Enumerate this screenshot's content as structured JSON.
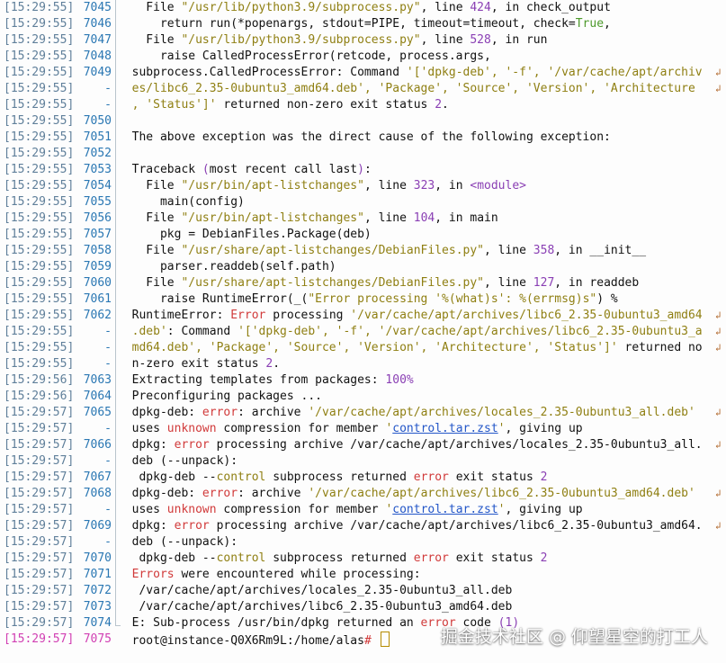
{
  "colors": {
    "background": "#fdfdfd",
    "timestamp": "#5f7f9a",
    "line_number": "#2a77b3",
    "active_line": "#d13fb3",
    "string": "#8f7f12",
    "number": "#8a3fb4",
    "error": "#d13a3a",
    "link": "#2356c8"
  },
  "icons": {
    "wrap": "wrap-continuation-icon",
    "cursor": "cursor-block-icon"
  },
  "terminal": {
    "lines": [
      {
        "ts": "[15:29:55]",
        "ln": "7045",
        "wrap": false,
        "segs": [
          [
            "plain",
            "    File "
          ],
          [
            "str",
            "\"/usr/lib/python3.9/subprocess.py\""
          ],
          [
            "plain",
            ", line "
          ],
          [
            "num",
            "424"
          ],
          [
            "plain",
            ", in check_output"
          ]
        ]
      },
      {
        "ts": "[15:29:55]",
        "ln": "7046",
        "wrap": false,
        "segs": [
          [
            "plain",
            "      return run(*popenargs, stdout=PIPE, timeout=timeout, check="
          ],
          [
            "green",
            "True"
          ],
          [
            "plain",
            ","
          ]
        ]
      },
      {
        "ts": "[15:29:55]",
        "ln": "7047",
        "wrap": false,
        "segs": [
          [
            "plain",
            "    File "
          ],
          [
            "str",
            "\"/usr/lib/python3.9/subprocess.py\""
          ],
          [
            "plain",
            ", line "
          ],
          [
            "num",
            "528"
          ],
          [
            "plain",
            ", in run"
          ]
        ]
      },
      {
        "ts": "[15:29:55]",
        "ln": "7048",
        "wrap": false,
        "segs": [
          [
            "plain",
            "      raise CalledProcessError(retcode, process.args,"
          ]
        ]
      },
      {
        "ts": "[15:29:55]",
        "ln": "7049",
        "wrap": true,
        "segs": [
          [
            "plain",
            "  subprocess.CalledProcessError: Command "
          ],
          [
            "str",
            "'['dpkg-deb', '-f', '/var/cache/apt/archiv"
          ]
        ]
      },
      {
        "ts": "[15:29:55]",
        "ln": "-",
        "wrap": true,
        "segs": [
          [
            "str",
            "  es/libc6_2.35-0ubuntu3_amd64.deb', 'Package', 'Source', 'Version', 'Architecture"
          ]
        ]
      },
      {
        "ts": "[15:29:55]",
        "ln": "-",
        "wrap": false,
        "segs": [
          [
            "str",
            "  , 'Status']'"
          ],
          [
            "plain",
            " returned non-zero exit status "
          ],
          [
            "num",
            "2"
          ],
          [
            "plain",
            "."
          ]
        ]
      },
      {
        "ts": "[15:29:55]",
        "ln": "7050",
        "wrap": false,
        "segs": [
          [
            "plain",
            ""
          ]
        ]
      },
      {
        "ts": "[15:29:55]",
        "ln": "7051",
        "wrap": false,
        "segs": [
          [
            "plain",
            "  The above exception was the direct cause of the following exception:"
          ]
        ]
      },
      {
        "ts": "[15:29:55]",
        "ln": "7052",
        "wrap": false,
        "segs": [
          [
            "plain",
            ""
          ]
        ]
      },
      {
        "ts": "[15:29:55]",
        "ln": "7053",
        "wrap": false,
        "segs": [
          [
            "plain",
            "  Traceback "
          ],
          [
            "kw",
            "("
          ],
          [
            "plain",
            "most recent call last"
          ],
          [
            "kw",
            ")"
          ],
          [
            "plain",
            ":"
          ]
        ]
      },
      {
        "ts": "[15:29:55]",
        "ln": "7054",
        "wrap": false,
        "segs": [
          [
            "plain",
            "    File "
          ],
          [
            "str",
            "\"/usr/bin/apt-listchanges\""
          ],
          [
            "plain",
            ", line "
          ],
          [
            "num",
            "323"
          ],
          [
            "plain",
            ", in "
          ],
          [
            "kw",
            "<module>"
          ]
        ]
      },
      {
        "ts": "[15:29:55]",
        "ln": "7055",
        "wrap": false,
        "segs": [
          [
            "plain",
            "      main(config)"
          ]
        ]
      },
      {
        "ts": "[15:29:55]",
        "ln": "7056",
        "wrap": false,
        "segs": [
          [
            "plain",
            "    File "
          ],
          [
            "str",
            "\"/usr/bin/apt-listchanges\""
          ],
          [
            "plain",
            ", line "
          ],
          [
            "num",
            "104"
          ],
          [
            "plain",
            ", in main"
          ]
        ]
      },
      {
        "ts": "[15:29:55]",
        "ln": "7057",
        "wrap": false,
        "segs": [
          [
            "plain",
            "      pkg = DebianFiles.Package(deb)"
          ]
        ]
      },
      {
        "ts": "[15:29:55]",
        "ln": "7058",
        "wrap": false,
        "segs": [
          [
            "plain",
            "    File "
          ],
          [
            "str",
            "\"/usr/share/apt-listchanges/DebianFiles.py\""
          ],
          [
            "plain",
            ", line "
          ],
          [
            "num",
            "358"
          ],
          [
            "plain",
            ", in __init__"
          ]
        ]
      },
      {
        "ts": "[15:29:55]",
        "ln": "7059",
        "wrap": false,
        "segs": [
          [
            "plain",
            "      parser.readdeb(self.path)"
          ]
        ]
      },
      {
        "ts": "[15:29:55]",
        "ln": "7060",
        "wrap": false,
        "segs": [
          [
            "plain",
            "    File "
          ],
          [
            "str",
            "\"/usr/share/apt-listchanges/DebianFiles.py\""
          ],
          [
            "plain",
            ", line "
          ],
          [
            "num",
            "127"
          ],
          [
            "plain",
            ", in readdeb"
          ]
        ]
      },
      {
        "ts": "[15:29:55]",
        "ln": "7061",
        "wrap": false,
        "segs": [
          [
            "plain",
            "      raise RuntimeError(_("
          ],
          [
            "str",
            "\"Error processing '%(what)s': %(errmsg)s\""
          ],
          [
            "plain",
            ") %"
          ]
        ]
      },
      {
        "ts": "[15:29:55]",
        "ln": "7062",
        "wrap": true,
        "segs": [
          [
            "plain",
            "  RuntimeError: "
          ],
          [
            "err",
            "Error"
          ],
          [
            "plain",
            " processing "
          ],
          [
            "str",
            "'/var/cache/apt/archives/libc6_2.35-0ubuntu3_amd64"
          ]
        ]
      },
      {
        "ts": "[15:29:55]",
        "ln": "-",
        "wrap": true,
        "segs": [
          [
            "str",
            "  .deb'"
          ],
          [
            "plain",
            ": Command "
          ],
          [
            "str",
            "'['dpkg-deb', '-f', '/var/cache/apt/archives/libc6_2.35-0ubuntu3_a"
          ]
        ]
      },
      {
        "ts": "[15:29:55]",
        "ln": "-",
        "wrap": true,
        "segs": [
          [
            "str",
            "  md64.deb', 'Package', 'Source', 'Version', 'Architecture', 'Status']'"
          ],
          [
            "plain",
            " returned no"
          ]
        ]
      },
      {
        "ts": "[15:29:55]",
        "ln": "-",
        "wrap": false,
        "segs": [
          [
            "plain",
            "  n-zero exit status "
          ],
          [
            "num",
            "2"
          ],
          [
            "plain",
            "."
          ]
        ]
      },
      {
        "ts": "[15:29:56]",
        "ln": "7063",
        "wrap": false,
        "segs": [
          [
            "plain",
            "  Extracting templates from packages: "
          ],
          [
            "num",
            "100%"
          ]
        ]
      },
      {
        "ts": "[15:29:56]",
        "ln": "7064",
        "wrap": false,
        "segs": [
          [
            "plain",
            "  Preconfiguring packages ..."
          ]
        ]
      },
      {
        "ts": "[15:29:57]",
        "ln": "7065",
        "wrap": true,
        "segs": [
          [
            "plain",
            "  dpkg-deb: "
          ],
          [
            "err",
            "error"
          ],
          [
            "plain",
            ": archive "
          ],
          [
            "str",
            "'/var/cache/apt/archives/locales_2.35-0ubuntu3_all.deb'"
          ]
        ]
      },
      {
        "ts": "[15:29:57]",
        "ln": "-",
        "wrap": false,
        "segs": [
          [
            "plain",
            "  uses "
          ],
          [
            "err",
            "unknown"
          ],
          [
            "plain",
            " compression for member "
          ],
          [
            "str",
            "'"
          ],
          [
            "link",
            "control.tar.zst"
          ],
          [
            "str",
            "'"
          ],
          [
            "plain",
            ", giving up"
          ]
        ]
      },
      {
        "ts": "[15:29:57]",
        "ln": "7066",
        "wrap": true,
        "segs": [
          [
            "plain",
            "  dpkg: "
          ],
          [
            "err",
            "error"
          ],
          [
            "plain",
            " processing archive /var/cache/apt/archives/locales_2.35-0ubuntu3_all."
          ]
        ]
      },
      {
        "ts": "[15:29:57]",
        "ln": "-",
        "wrap": false,
        "segs": [
          [
            "plain",
            "  deb (--unpack):"
          ]
        ]
      },
      {
        "ts": "[15:29:57]",
        "ln": "7067",
        "wrap": false,
        "segs": [
          [
            "plain",
            "   dpkg-deb --"
          ],
          [
            "str",
            "control"
          ],
          [
            "plain",
            " subprocess returned "
          ],
          [
            "err",
            "error"
          ],
          [
            "plain",
            " exit status "
          ],
          [
            "num",
            "2"
          ]
        ]
      },
      {
        "ts": "[15:29:57]",
        "ln": "7068",
        "wrap": true,
        "segs": [
          [
            "plain",
            "  dpkg-deb: "
          ],
          [
            "err",
            "error"
          ],
          [
            "plain",
            ": archive "
          ],
          [
            "str",
            "'/var/cache/apt/archives/libc6_2.35-0ubuntu3_amd64.deb'"
          ]
        ]
      },
      {
        "ts": "[15:29:57]",
        "ln": "-",
        "wrap": false,
        "segs": [
          [
            "plain",
            "  uses "
          ],
          [
            "err",
            "unknown"
          ],
          [
            "plain",
            " compression for member "
          ],
          [
            "str",
            "'"
          ],
          [
            "link",
            "control.tar.zst"
          ],
          [
            "str",
            "'"
          ],
          [
            "plain",
            ", giving up"
          ]
        ]
      },
      {
        "ts": "[15:29:57]",
        "ln": "7069",
        "wrap": true,
        "segs": [
          [
            "plain",
            "  dpkg: "
          ],
          [
            "err",
            "error"
          ],
          [
            "plain",
            " processing archive /var/cache/apt/archives/libc6_2.35-0ubuntu3_amd64."
          ]
        ]
      },
      {
        "ts": "[15:29:57]",
        "ln": "-",
        "wrap": false,
        "segs": [
          [
            "plain",
            "  deb (--unpack):"
          ]
        ]
      },
      {
        "ts": "[15:29:57]",
        "ln": "7070",
        "wrap": false,
        "segs": [
          [
            "plain",
            "   dpkg-deb --"
          ],
          [
            "str",
            "control"
          ],
          [
            "plain",
            " subprocess returned "
          ],
          [
            "err",
            "error"
          ],
          [
            "plain",
            " exit status "
          ],
          [
            "num",
            "2"
          ]
        ]
      },
      {
        "ts": "[15:29:57]",
        "ln": "7071",
        "wrap": false,
        "segs": [
          [
            "err",
            "  Errors"
          ],
          [
            "plain",
            " were encountered while processing:"
          ]
        ]
      },
      {
        "ts": "[15:29:57]",
        "ln": "7072",
        "wrap": false,
        "segs": [
          [
            "plain",
            "   /var/cache/apt/archives/locales_2.35-0ubuntu3_all.deb"
          ]
        ]
      },
      {
        "ts": "[15:29:57]",
        "ln": "7073",
        "wrap": false,
        "segs": [
          [
            "plain",
            "   /var/cache/apt/archives/libc6_2.35-0ubuntu3_amd64.deb"
          ]
        ]
      },
      {
        "ts": "[15:29:57]",
        "ln": "7074",
        "wrap": false,
        "segs": [
          [
            "plain",
            "  E: Sub-process /usr/bin/dpkg returned an "
          ],
          [
            "err",
            "error"
          ],
          [
            "plain",
            " code "
          ],
          [
            "kw",
            "("
          ],
          [
            "num",
            "1"
          ],
          [
            "kw",
            ")"
          ]
        ]
      },
      {
        "ts": "[15:29:57]",
        "ln": "7075",
        "wrap": false,
        "active": true,
        "prompt": true,
        "segs": [
          [
            "plain",
            "  root@instance-Q0X6Rm9L:/home/alas"
          ],
          [
            "err",
            "#"
          ],
          [
            "plain",
            " "
          ]
        ]
      }
    ]
  },
  "watermark": "掘金技术社区 @ 仰望星空的打工人"
}
